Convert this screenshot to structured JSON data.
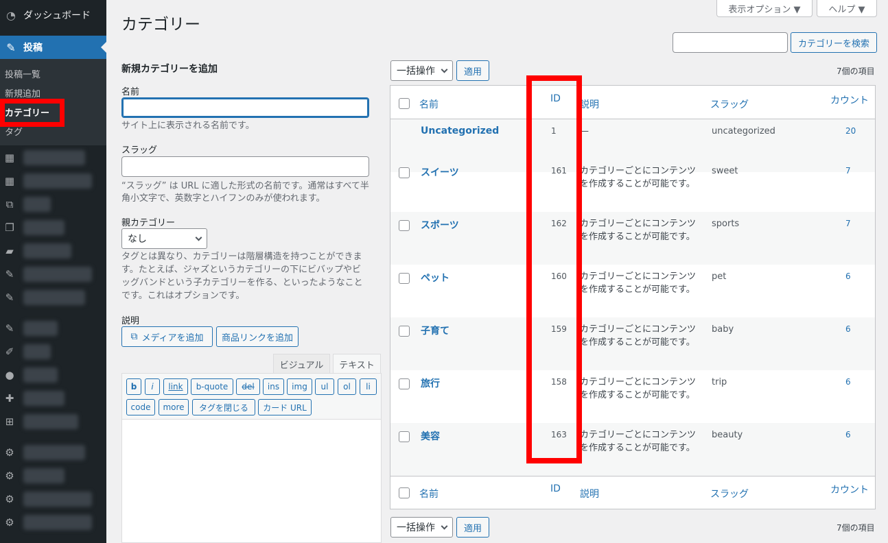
{
  "sidebar": {
    "dashboard": "ダッシュボード",
    "posts": "投稿",
    "submenu": [
      "投稿一覧",
      "新規追加",
      "カテゴリー",
      "タグ"
    ],
    "blurred_icons": [
      "grid-icon",
      "grid-icon",
      "media-icon",
      "pages-icon",
      "comment-icon",
      "pin-icon",
      "pin-icon",
      "pin-icon",
      "brush-icon",
      "user-icon",
      "wrench-icon",
      "plus-box-icon",
      "gear-icon",
      "gear-icon",
      "gear-icon",
      "gear-icon"
    ]
  },
  "screen_meta": {
    "options": "表示オプション ▼",
    "help": "ヘルプ ▼"
  },
  "page": {
    "title": "カテゴリー"
  },
  "search": {
    "button": "カテゴリーを検索",
    "value": ""
  },
  "form": {
    "heading": "新規カテゴリーを追加",
    "name_label": "名前",
    "name_help": "サイト上に表示される名前です。",
    "slug_label": "スラッグ",
    "slug_help_1": "“スラッグ” は URL に適した形式の名前です。通常はすべて半",
    "slug_help_2": "角小文字で、英数字とハイフンのみが使われます。",
    "parent_label": "親カテゴリー",
    "parent_value": "なし",
    "parent_help_1": "タグとは異なり、カテゴリーは階層構造を持つことができま",
    "parent_help_2": "す。たとえば、ジャズというカテゴリーの下にビバップやビ",
    "parent_help_3": "ッグバンドという子カテゴリーを作る、といったようなこと",
    "parent_help_4": "です。これはオプションです。",
    "desc_label": "説明",
    "media_button": "メディアを追加",
    "product_button": "商品リンクを追加",
    "tab_visual": "ビジュアル",
    "tab_text": "テキスト",
    "quicktags": [
      "b",
      "i",
      "link",
      "b-quote",
      "del",
      "ins",
      "img",
      "ul",
      "ol",
      "li",
      "code",
      "more",
      "タグを閉じる",
      "カード URL"
    ]
  },
  "table": {
    "bulk_action": "一括操作",
    "apply": "適用",
    "item_count": "7個の項目",
    "headers": {
      "name": "名前",
      "id": "ID",
      "description": "説明",
      "slug": "スラッグ",
      "count": "カウント"
    },
    "rows": [
      {
        "name": "Uncategorized",
        "id": "1",
        "description": "—",
        "slug": "uncategorized",
        "count": "20",
        "checkbox": false
      },
      {
        "name": "スイーツ",
        "id": "161",
        "description": "カテゴリーごとにコンテンツを作成することが可能です。",
        "slug": "sweet",
        "count": "7",
        "checkbox": true
      },
      {
        "name": "スポーツ",
        "id": "162",
        "description": "カテゴリーごとにコンテンツを作成することが可能です。",
        "slug": "sports",
        "count": "7",
        "checkbox": true
      },
      {
        "name": "ペット",
        "id": "160",
        "description": "カテゴリーごとにコンテンツを作成することが可能です。",
        "slug": "pet",
        "count": "6",
        "checkbox": true
      },
      {
        "name": "子育て",
        "id": "159",
        "description": "カテゴリーごとにコンテンツを作成することが可能です。",
        "slug": "baby",
        "count": "6",
        "checkbox": true
      },
      {
        "name": "旅行",
        "id": "158",
        "description": "カテゴリーごとにコンテンツを作成することが可能です。",
        "slug": "trip",
        "count": "6",
        "checkbox": true
      },
      {
        "name": "美容",
        "id": "163",
        "description": "カテゴリーごとにコンテンツを作成することが可能です。",
        "slug": "beauty",
        "count": "6",
        "checkbox": true
      }
    ]
  },
  "colors": {
    "accent": "#2271b1",
    "highlight": "#ff0000",
    "sidebar": "#1d2327"
  }
}
